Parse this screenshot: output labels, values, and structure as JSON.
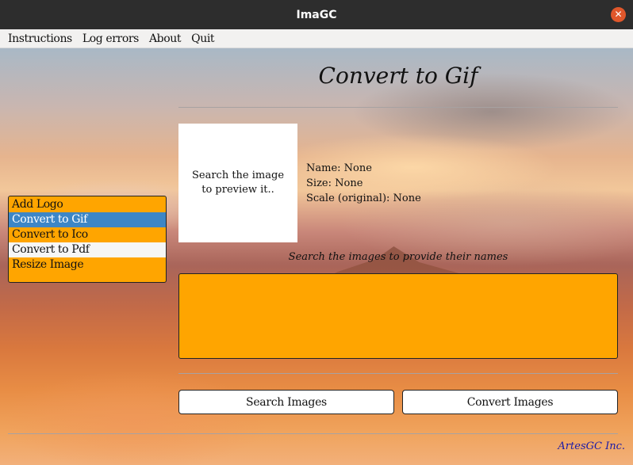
{
  "window": {
    "title": "ImaGC"
  },
  "menu": [
    "Instructions",
    "Log errors",
    "About",
    "Quit"
  ],
  "main": {
    "title": "Convert to Gif",
    "preview_text": "Search the image to preview it..",
    "info": {
      "name": "Name: None",
      "size": "Size: None",
      "scale": "Scale (original): None"
    },
    "names_hint": "Search the images to provide their names",
    "names_value": ""
  },
  "sidebar": {
    "items": [
      "Add Logo",
      "Convert to Gif",
      "Convert to Ico",
      "Convert to Pdf",
      "Resize Image"
    ],
    "selected": "Convert to Gif"
  },
  "buttons": {
    "search": "Search Images",
    "convert": "Convert Images"
  },
  "footer": {
    "credit": "ArtesGC Inc."
  },
  "colors": {
    "accent_orange": "#ffa500",
    "selection_blue": "#3d86c6",
    "close_button": "#e0572b",
    "footer_link": "#1a1aa8"
  },
  "icons": {
    "close": "close-icon"
  }
}
